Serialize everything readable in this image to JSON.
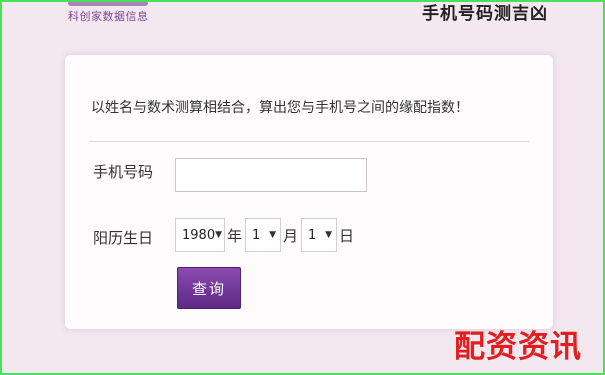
{
  "header": {
    "logo_text": "科创家数据信息",
    "title": "手机号码测吉凶"
  },
  "form": {
    "intro": "以姓名与数术测算相结合，算出您与手机号之间的缘配指数！",
    "phone_label": "手机号码",
    "phone_value": "",
    "birth_label": "阳历生日",
    "year_value": "1980",
    "year_unit": "年",
    "month_value": "1",
    "month_unit": "月",
    "day_value": "1",
    "day_unit": "日",
    "query_label": "查询"
  },
  "watermark": "配资资讯",
  "colors": {
    "accent": "#6b3495",
    "frame": "#49e05a",
    "watermark": "#e02020"
  }
}
